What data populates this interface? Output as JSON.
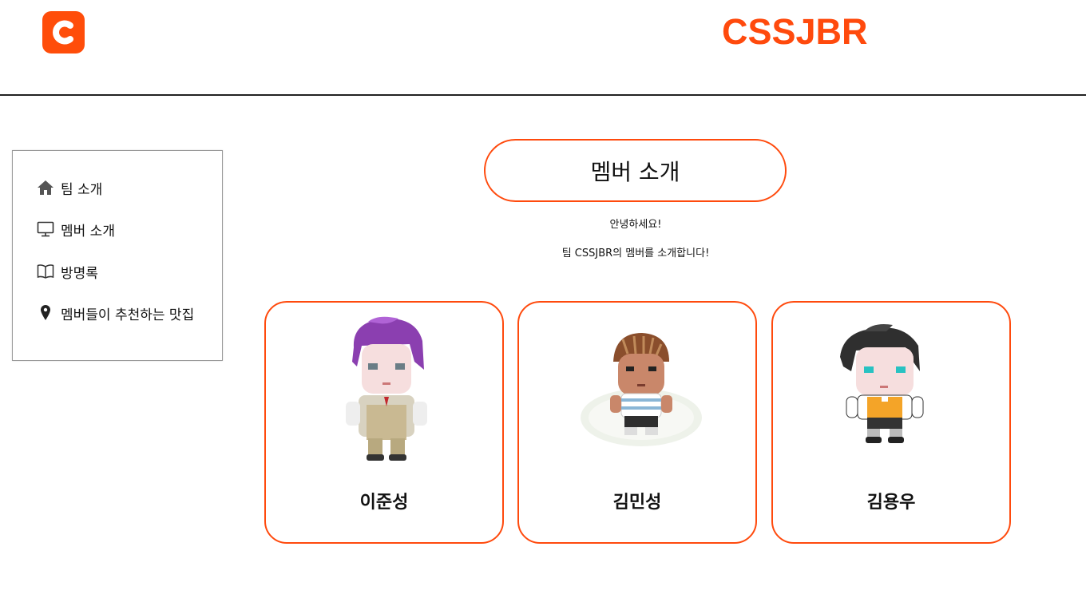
{
  "header": {
    "brand": "CSSJBR",
    "logo_icon": "c-logo-icon",
    "accent": "#ff4a0d"
  },
  "sidebar": {
    "items": [
      {
        "label": "팀 소개",
        "icon": "home-icon"
      },
      {
        "label": "멤버 소개",
        "icon": "monitor-icon"
      },
      {
        "label": "방명록",
        "icon": "book-icon"
      },
      {
        "label": "멤버들이 추천하는 맛집",
        "icon": "map-pin-icon"
      }
    ]
  },
  "main": {
    "title": "멤버 소개",
    "intro_line1": "안녕하세요!",
    "intro_line2": "팀 CSSJBR의 멤버를 소개합니다!",
    "members": [
      {
        "name": "이준성",
        "avatar": "purple-hair-avatar"
      },
      {
        "name": "김민성",
        "avatar": "braided-hair-avatar"
      },
      {
        "name": "김용우",
        "avatar": "dark-hair-avatar"
      }
    ]
  }
}
